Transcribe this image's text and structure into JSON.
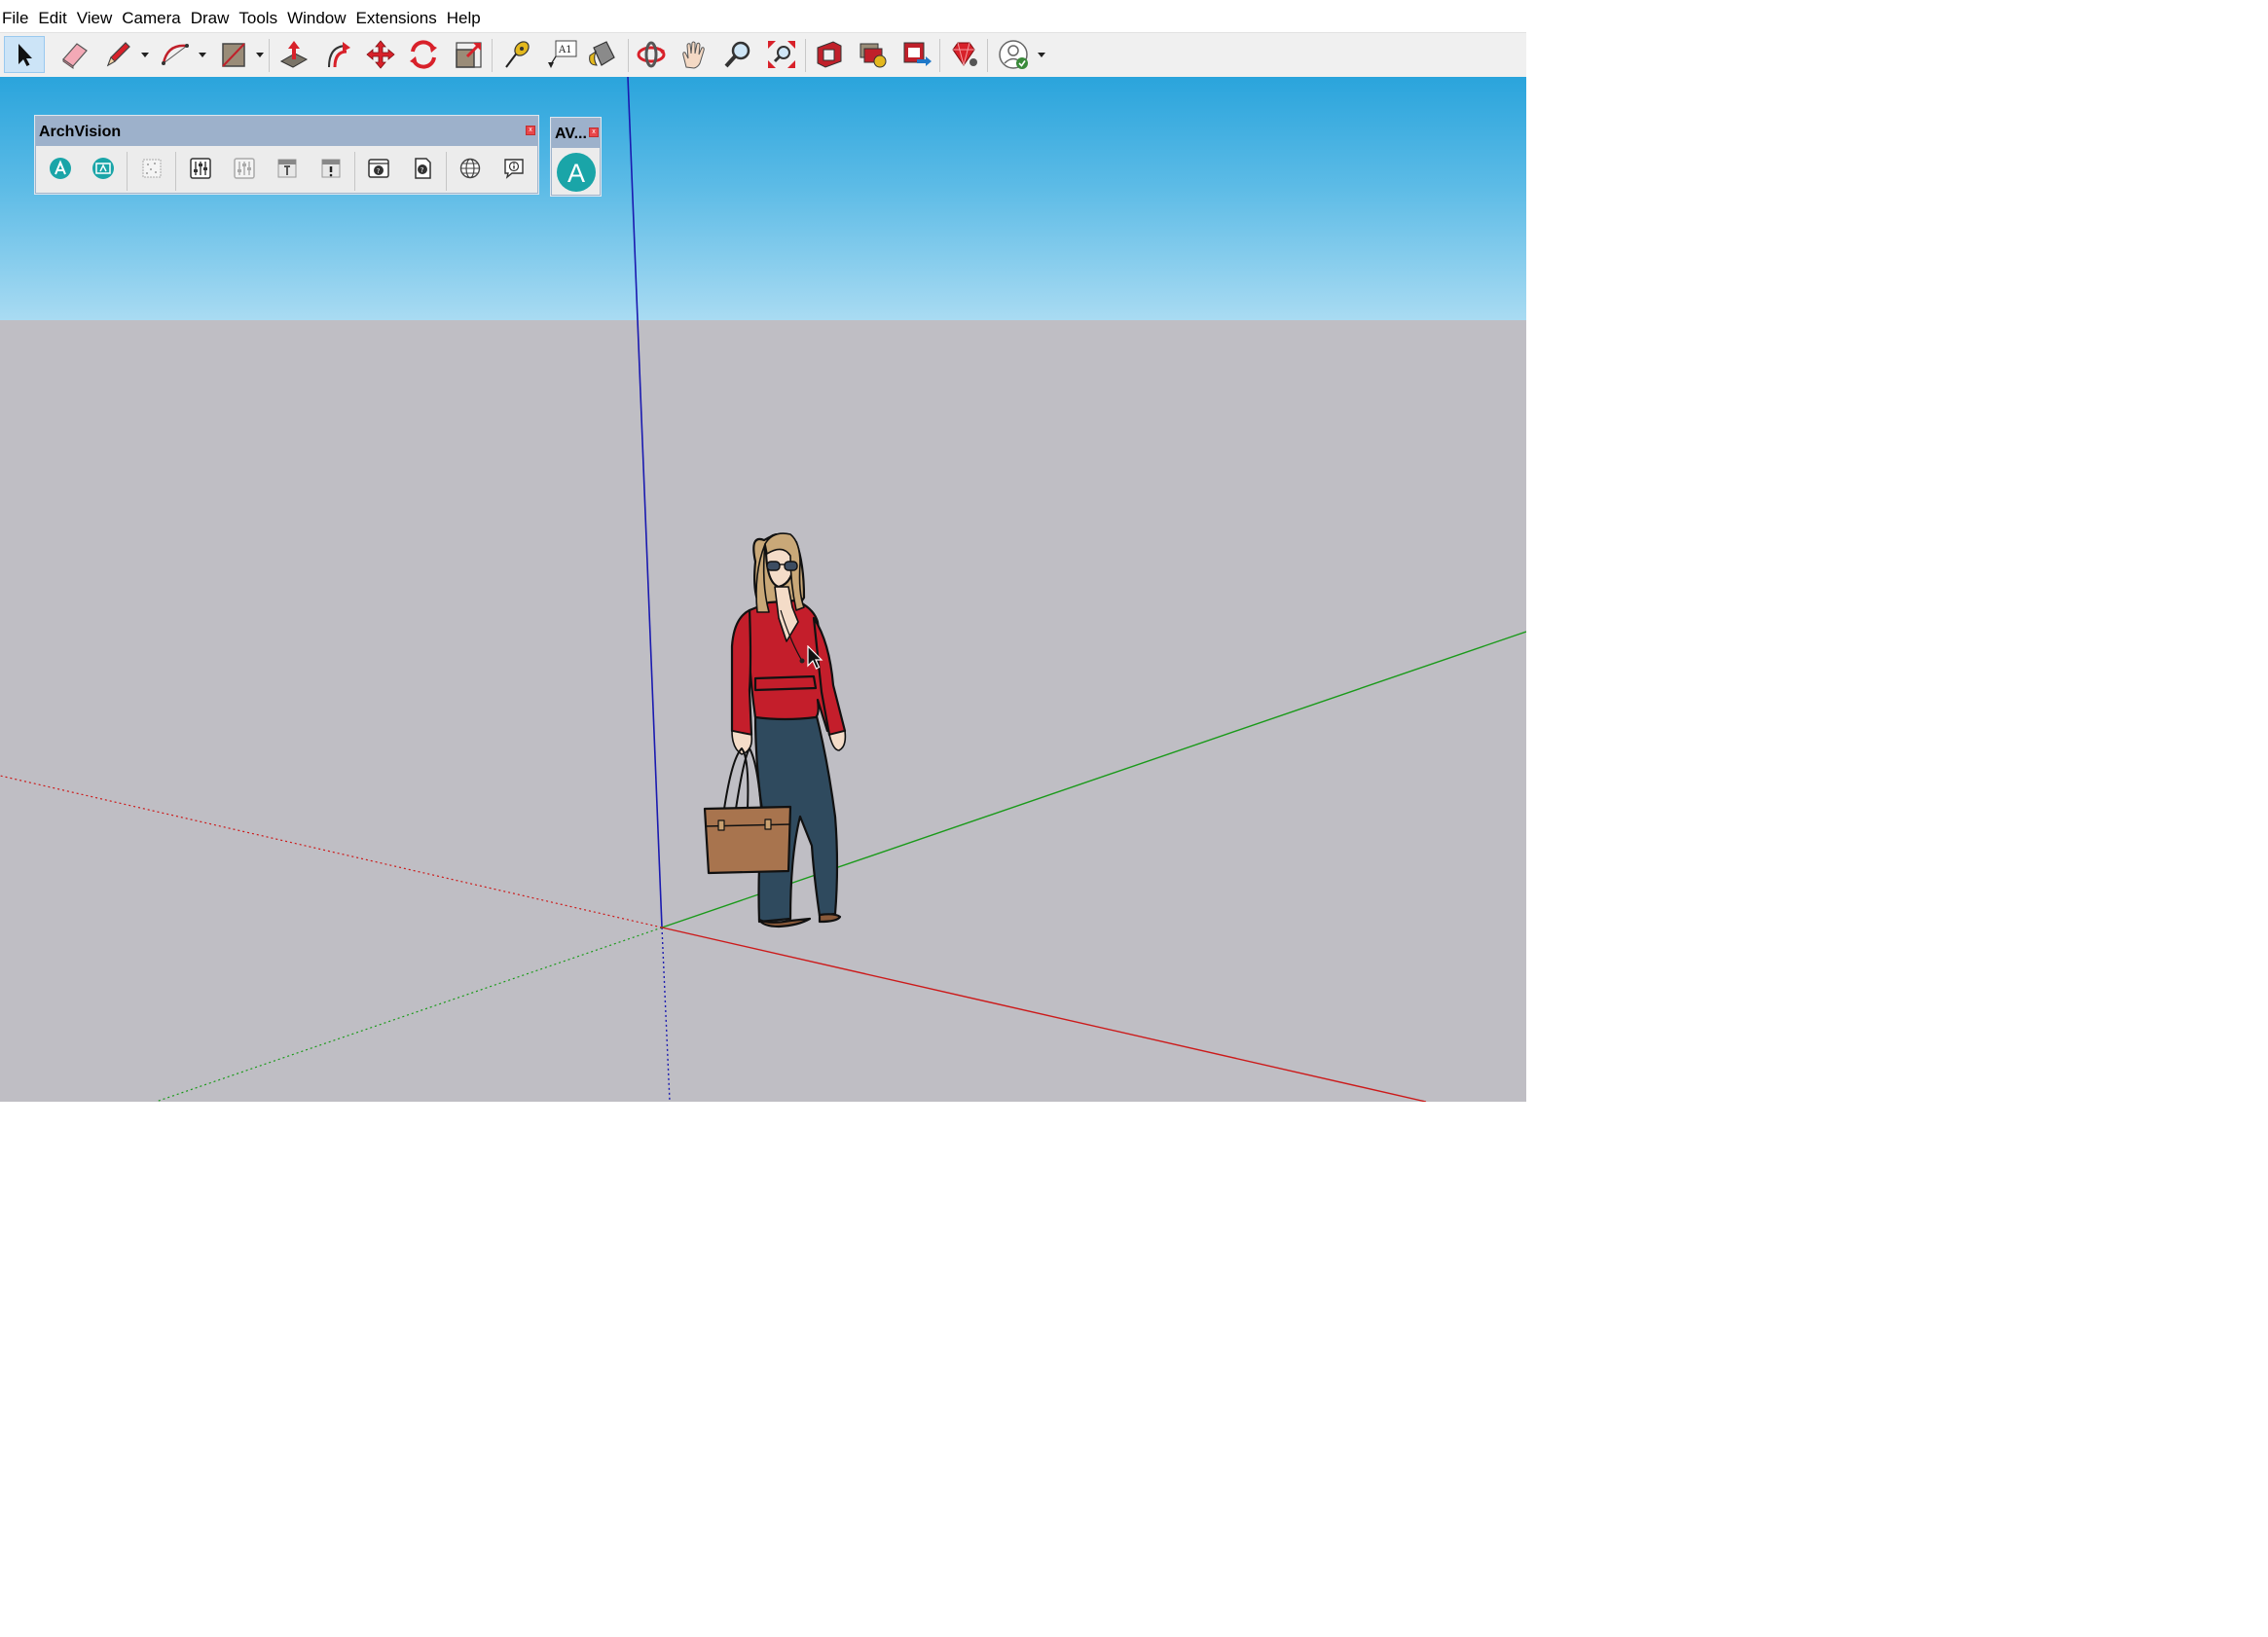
{
  "menu": {
    "items": [
      "File",
      "Edit",
      "View",
      "Camera",
      "Draw",
      "Tools",
      "Window",
      "Extensions",
      "Help"
    ]
  },
  "toolbar": {
    "tools": [
      {
        "name": "select-tool-button",
        "icon": "arrow-cursor-icon",
        "active": true
      },
      {
        "name": "eraser-tool-button",
        "icon": "eraser-icon"
      },
      {
        "name": "pencil-tool-button",
        "icon": "pencil-icon"
      },
      {
        "name": "arc-tool-button",
        "icon": "arc-icon"
      },
      {
        "name": "rectangle-tool-button",
        "icon": "rectangle-icon"
      },
      {
        "name": "push-pull-tool-button",
        "icon": "push-pull-icon"
      },
      {
        "name": "offset-tool-button",
        "icon": "offset-icon"
      },
      {
        "name": "move-tool-button",
        "icon": "move-icon"
      },
      {
        "name": "rotate-tool-button",
        "icon": "rotate-icon"
      },
      {
        "name": "scale-tool-button",
        "icon": "scale-icon"
      },
      {
        "name": "tape-measure-tool-button",
        "icon": "tape-measure-icon"
      },
      {
        "name": "text-tool-button",
        "icon": "text-icon"
      },
      {
        "name": "paint-bucket-tool-button",
        "icon": "paint-bucket-icon"
      },
      {
        "name": "orbit-tool-button",
        "icon": "orbit-icon"
      },
      {
        "name": "pan-tool-button",
        "icon": "pan-hand-icon"
      },
      {
        "name": "zoom-tool-button",
        "icon": "zoom-icon"
      },
      {
        "name": "zoom-extents-tool-button",
        "icon": "zoom-extents-icon"
      },
      {
        "name": "warehouse-button",
        "icon": "3d-warehouse-icon"
      },
      {
        "name": "share-model-button",
        "icon": "share-model-icon"
      },
      {
        "name": "extension-warehouse-button",
        "icon": "extension-warehouse-icon"
      },
      {
        "name": "ruby-console-button",
        "icon": "ruby-icon"
      },
      {
        "name": "account-button",
        "icon": "user-account-icon"
      }
    ],
    "text_tool_label": "A1"
  },
  "panels": {
    "archvision": {
      "title": "ArchVision",
      "close_label": "x",
      "buttons": [
        "archvision-logo-icon",
        "archvision-display-icon",
        "scatter-icon",
        "sliders-icon",
        "sliders-disabled-icon",
        "text-placeholder-icon",
        "alert-placeholder-icon",
        "help-window-icon",
        "help-document-icon",
        "globe-icon",
        "info-icon"
      ]
    },
    "av_small": {
      "title": "AV...",
      "close_label": "x",
      "logo_letter": "A"
    }
  },
  "scene": {
    "colors": {
      "x_axis": "#cc1a1a",
      "y_axis": "#1a9a1a",
      "z_axis": "#1a1ab0",
      "sky_top": "#2aa4dc",
      "sky_bottom": "#a9dbf2",
      "ground": "#bfbec4",
      "shirt": "#c41e2b",
      "pants": "#2f4a5e",
      "hair": "#c9a878",
      "bag": "#a8744e"
    }
  }
}
